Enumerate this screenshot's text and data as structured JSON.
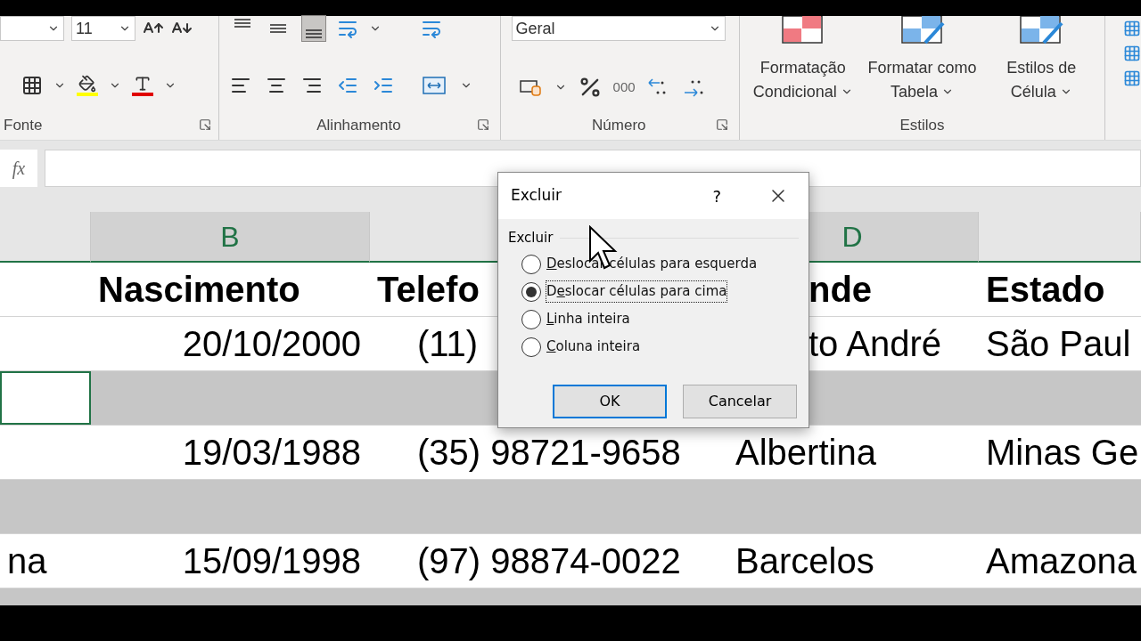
{
  "ribbon": {
    "font_size": "11",
    "number_format": "Geral",
    "comma_label": "000",
    "groups": [
      {
        "label": "Fonte"
      },
      {
        "label": "Alinhamento"
      },
      {
        "label": "Número"
      },
      {
        "label": "Estilos"
      }
    ],
    "vertical_align_buttons": [
      {
        "selected": false
      },
      {
        "selected": false
      },
      {
        "selected": true
      }
    ],
    "style_buttons": [
      {
        "line1": "Formatação",
        "line2": "Condicional"
      },
      {
        "line1": "Formatar como",
        "line2": "Tabela"
      },
      {
        "line1": "Estilos de",
        "line2": "Célula"
      }
    ]
  },
  "formula_bar": {
    "function_label": "fx"
  },
  "sheet": {
    "columns": [
      {
        "selected": false
      },
      {
        "label": "B",
        "selected": true
      },
      {
        "selected": false
      },
      {
        "label": "D",
        "selected": true
      },
      {
        "selected": false
      }
    ],
    "rows": [
      {
        "kind": "header",
        "selected": false,
        "cells": [
          {
            "active": false
          },
          {
            "text": "Nascimento",
            "active": false
          },
          {
            "text": "Telefo",
            "active": false
          },
          {
            "text": "nde",
            "active": false
          },
          {
            "text": "Estado",
            "active": false
          }
        ]
      },
      {
        "kind": "data",
        "selected": false,
        "cells": [
          {
            "active": false
          },
          {
            "text": "20/10/2000",
            "active": false
          },
          {
            "text": "(11)",
            "active": false
          },
          {
            "text": "to André",
            "active": false
          },
          {
            "text": "São Paul",
            "active": false
          }
        ]
      },
      {
        "kind": "data",
        "selected": true,
        "cells": [
          {
            "active": true
          },
          {
            "active": false
          },
          {
            "active": false
          },
          {
            "active": false
          },
          {
            "active": false
          }
        ]
      },
      {
        "kind": "data",
        "selected": false,
        "cells": [
          {
            "active": false
          },
          {
            "text": "19/03/1988",
            "active": false
          },
          {
            "text": "(35) 98721-9658",
            "active": false
          },
          {
            "text": "Albertina",
            "active": false
          },
          {
            "text": "Minas Ge",
            "active": false
          }
        ]
      },
      {
        "kind": "data",
        "selected": true,
        "cells": [
          {
            "active": false
          },
          {
            "active": false
          },
          {
            "active": false
          },
          {
            "active": false
          },
          {
            "active": false
          }
        ]
      },
      {
        "kind": "data",
        "selected": false,
        "cells": [
          {
            "text": "na",
            "active": false
          },
          {
            "text": "15/09/1998",
            "active": false
          },
          {
            "text": "(97) 98874-0022",
            "active": false
          },
          {
            "text": "Barcelos",
            "active": false
          },
          {
            "text": "Amazona",
            "active": false
          }
        ]
      },
      {
        "kind": "data",
        "selected": true,
        "cells": [
          {
            "active": false
          },
          {
            "active": false
          },
          {
            "active": false
          },
          {
            "active": false
          },
          {
            "active": false
          }
        ]
      }
    ]
  },
  "dialog": {
    "title": "Excluir",
    "help": "?",
    "group_label": "Excluir",
    "options": [
      {
        "key": "D",
        "rest": "eslocar células para esquerda",
        "selected": false,
        "focused": false
      },
      {
        "lead": "D",
        "key": "e",
        "rest": "slocar células para cima",
        "selected": true,
        "focused": true
      },
      {
        "key": "L",
        "rest": "inha inteira",
        "selected": false,
        "focused": false
      },
      {
        "key": "C",
        "rest": "oluna inteira",
        "selected": false,
        "focused": false
      }
    ],
    "buttons": [
      {
        "label": "OK",
        "default": true
      },
      {
        "label": "Cancelar",
        "default": false
      }
    ]
  }
}
